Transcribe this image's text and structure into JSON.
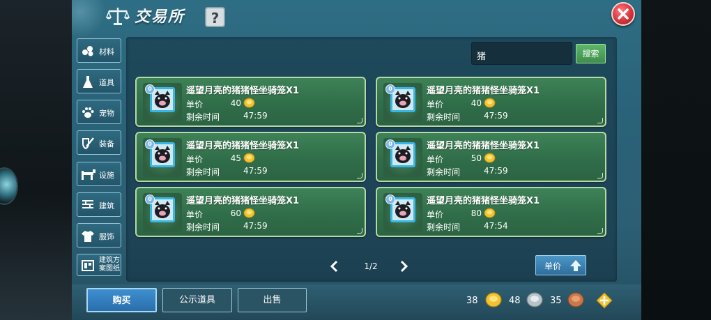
{
  "window": {
    "title": "交易所",
    "help_label": "?"
  },
  "categories": [
    {
      "label": "材料",
      "icon": "materials-icon"
    },
    {
      "label": "道具",
      "icon": "potion-icon"
    },
    {
      "label": "宠物",
      "icon": "paw-icon"
    },
    {
      "label": "装备",
      "icon": "sword-shield-icon"
    },
    {
      "label": "设施",
      "icon": "facility-icon"
    },
    {
      "label": "建筑",
      "icon": "building-icon"
    },
    {
      "label": "服饰",
      "icon": "clothing-icon"
    },
    {
      "label": "建筑方案图纸",
      "icon": "blueprint-icon"
    }
  ],
  "search": {
    "value": "猪",
    "button_label": "搜索"
  },
  "labels": {
    "price": "单价",
    "remaining": "剩余时间"
  },
  "listings": [
    {
      "name": "遥望月亮的猪猪怪坐骑笼X1",
      "price": "40",
      "time": "47:59",
      "badge": "0"
    },
    {
      "name": "遥望月亮的猪猪怪坐骑笼X1",
      "price": "40",
      "time": "47:59",
      "badge": "0"
    },
    {
      "name": "遥望月亮的猪猪怪坐骑笼X1",
      "price": "45",
      "time": "47:59",
      "badge": "0"
    },
    {
      "name": "遥望月亮的猪猪怪坐骑笼X1",
      "price": "50",
      "time": "47:59",
      "badge": "0"
    },
    {
      "name": "遥望月亮的猪猪怪坐骑笼X1",
      "price": "60",
      "time": "47:59",
      "badge": "0"
    },
    {
      "name": "遥望月亮的猪猪怪坐骑笼X1",
      "price": "80",
      "time": "47:54",
      "badge": "0"
    }
  ],
  "pager": {
    "text": "1/2"
  },
  "sort": {
    "label": "单价"
  },
  "tabs": {
    "buy": "购买",
    "public": "公示道具",
    "sell": "出售"
  },
  "currency": {
    "gold": "38",
    "silver": "48",
    "copper": "35"
  },
  "colors": {
    "panel": "#2c6a80",
    "card": "#357552",
    "gold_coin": "#f2c230",
    "close": "#d8333b"
  }
}
